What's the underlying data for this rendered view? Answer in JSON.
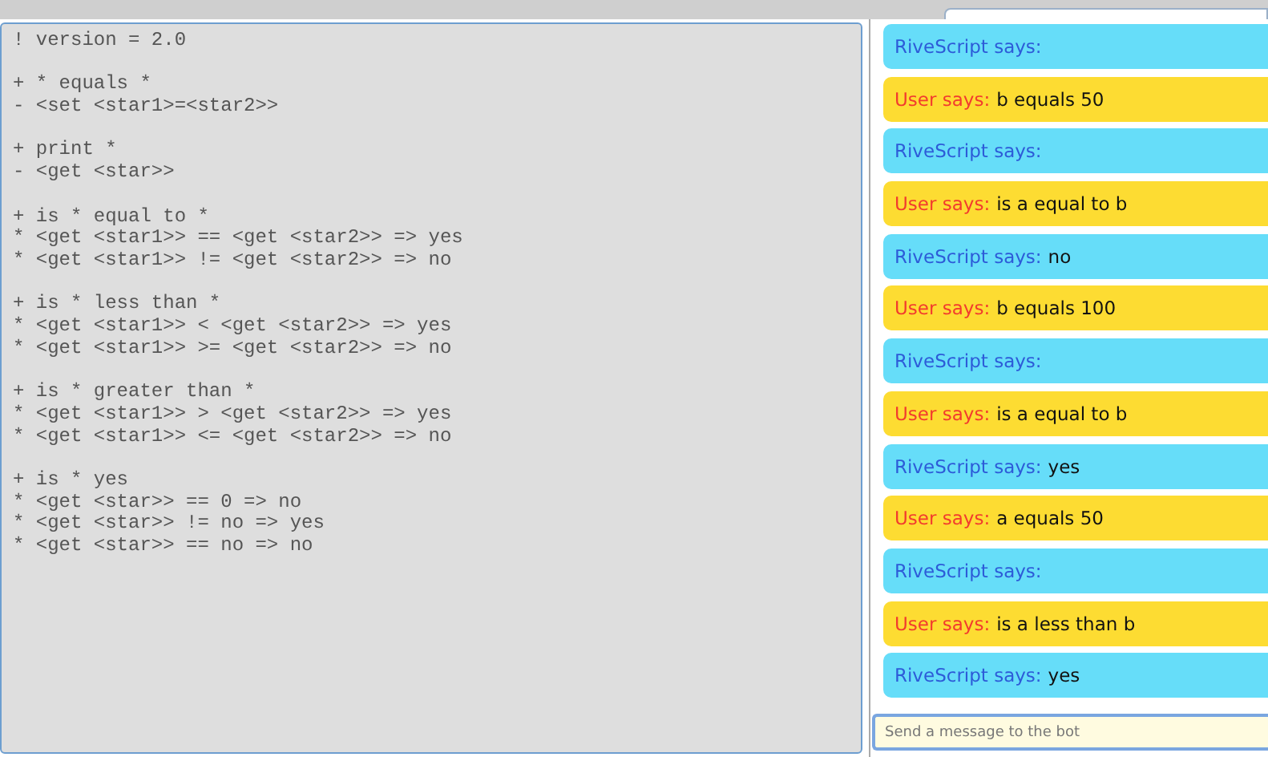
{
  "editor": {
    "blocks": [
      [
        "! version = 2.0"
      ],
      [
        "+ * equals *",
        "- <set <star1>=<star2>>"
      ],
      [
        "+ print *",
        "- <get <star>>"
      ],
      [
        "+ is * equal to *",
        "* <get <star1>> == <get <star2>> => yes",
        "* <get <star1>> != <get <star2>> => no"
      ],
      [
        "+ is * less than *",
        "* <get <star1>> < <get <star2>> => yes",
        "* <get <star1>> >= <get <star2>> => no"
      ],
      [
        "+ is * greater than *",
        "* <get <star1>> > <get <star2>> => yes",
        "* <get <star1>> <= <get <star2>> => no"
      ],
      [
        "+ is * yes",
        "* <get <star>> == 0 => no",
        "* <get <star>> != no => yes",
        "* <get <star>> == no => no"
      ]
    ]
  },
  "chat": {
    "messages": [
      {
        "kind": "bot",
        "speaker": "RiveScript says:"
      },
      {
        "kind": "user",
        "speaker": "User says:",
        "text": "b equals 50"
      },
      {
        "kind": "bot",
        "speaker": "RiveScript says:"
      },
      {
        "kind": "user",
        "speaker": "User says:",
        "text": "is a equal to b"
      },
      {
        "kind": "bot",
        "speaker": "RiveScript says:",
        "text": "no"
      },
      {
        "kind": "user",
        "speaker": "User says:",
        "text": "b equals 100"
      },
      {
        "kind": "bot",
        "speaker": "RiveScript says:"
      },
      {
        "kind": "user",
        "speaker": "User says:",
        "text": "is a equal to b"
      },
      {
        "kind": "bot",
        "speaker": "RiveScript says:",
        "text": "yes"
      },
      {
        "kind": "user",
        "speaker": "User says:",
        "text": "a equals 50"
      },
      {
        "kind": "bot",
        "speaker": "RiveScript says:"
      },
      {
        "kind": "user",
        "speaker": "User says:",
        "text": "is a less than b"
      },
      {
        "kind": "bot",
        "speaker": "RiveScript says:",
        "text": "yes"
      }
    ],
    "input": {
      "placeholder": "Send a message to the bot"
    }
  }
}
